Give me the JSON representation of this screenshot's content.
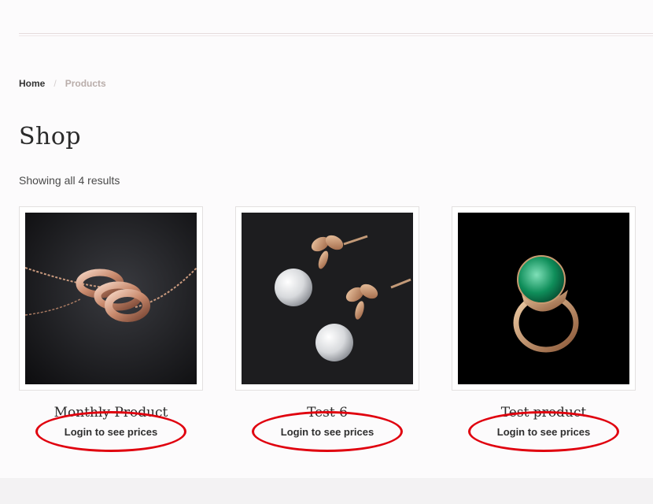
{
  "breadcrumb": {
    "home": "Home",
    "separator": "/",
    "current": "Products"
  },
  "page": {
    "title": "Shop",
    "result_count": "Showing all 4 results"
  },
  "products": [
    {
      "title": "Monthly Product",
      "login_label": "Login to see prices",
      "image": "rose-gold-rings-necklace"
    },
    {
      "title": "Test 6",
      "login_label": "Login to see prices",
      "image": "pearl-bow-earrings"
    },
    {
      "title": "Test product",
      "login_label": "Login to see prices",
      "image": "emerald-ring"
    }
  ],
  "colors": {
    "annotation_circle": "#e0000e",
    "breadcrumb_current": "#b9adaa"
  }
}
